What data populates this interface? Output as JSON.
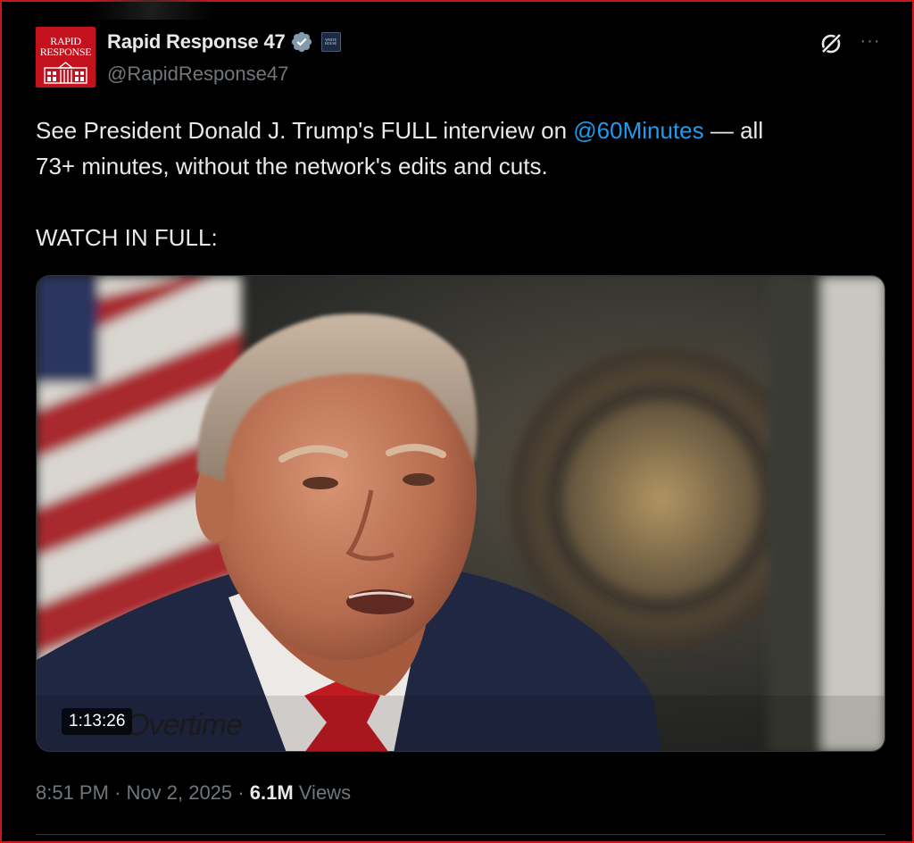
{
  "account": {
    "display_name": "Rapid Response 47",
    "handle": "@RapidResponse47",
    "avatar_text_line1": "RAPID",
    "avatar_text_line2": "RESPONSE",
    "affiliate_badge_text": "WHITE HOUSE",
    "verified_icon": "verified-badge-icon"
  },
  "actions": {
    "grok_icon": "grok-icon",
    "more_label": "···"
  },
  "post": {
    "text_before_mention": "See President Donald J. Trump's FULL interview on ",
    "mention": "@60Minutes",
    "text_after_mention": " — all",
    "line2": "73+ minutes, without the network's edits and cuts.",
    "line3": "WATCH IN FULL:"
  },
  "video": {
    "duration": "1:13:26",
    "watermark": "Overtime"
  },
  "meta": {
    "time": "8:51 PM",
    "separator": "·",
    "date": "Nov 2, 2025",
    "views_count": "6.1M",
    "views_label": "Views"
  },
  "colors": {
    "background": "#000000",
    "text": "#e7e9ea",
    "muted": "#71767b",
    "link": "#1d9bf0",
    "avatar_red": "#c3121e",
    "frame_red": "#c8161d"
  }
}
